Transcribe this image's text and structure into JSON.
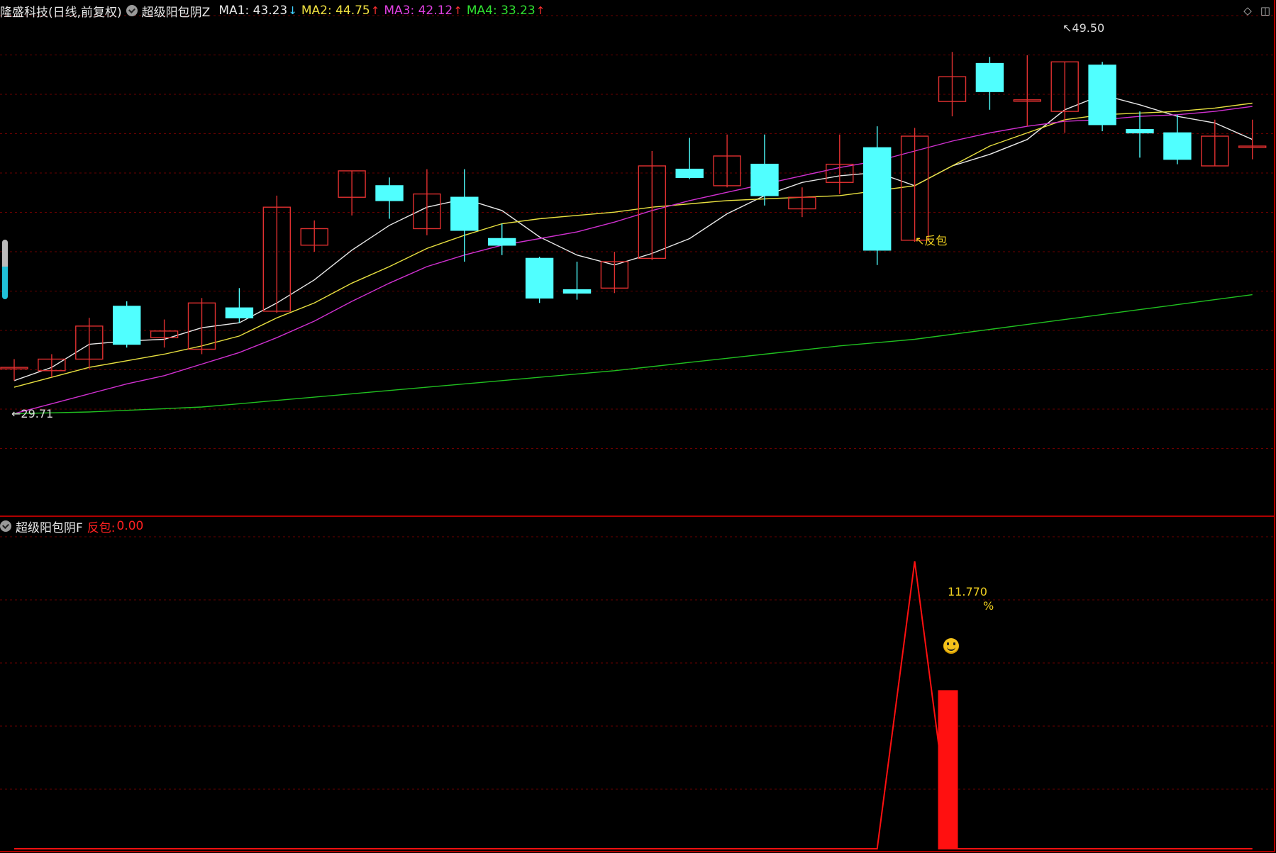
{
  "header": {
    "stock_title": "隆盛科技(日线,前复权)",
    "indicator_name": "超级阳包阴Z",
    "ma": [
      {
        "label": "MA1:",
        "value": "43.23",
        "arrow": "↓",
        "color": "#e8e8e8"
      },
      {
        "label": "MA2:",
        "value": "44.75",
        "arrow": "↑",
        "color": "#f0e040"
      },
      {
        "label": "MA3:",
        "value": "42.12",
        "arrow": "↑",
        "color": "#e040e0"
      },
      {
        "label": "MA4:",
        "value": "33.23",
        "arrow": "↑",
        "color": "#30e030"
      }
    ],
    "arrow_up_color": "#ff3030",
    "arrow_down_color": "#40d0ff"
  },
  "sub_header": {
    "indicator_name": "超级阳包阴F",
    "field_label": "反包:",
    "field_value": "0.00"
  },
  "annotations": {
    "high_label": "49.50",
    "low_label": "29.71",
    "signal_label": "反包",
    "percent_value": "11.770",
    "percent_sign": "%"
  },
  "icons": {
    "collapse": "circle-chevron-icon",
    "diamond": "diamond-icon",
    "window": "window-icon",
    "smiley": "smiley-icon"
  },
  "colors": {
    "up_candle": "#e03030",
    "down_candle": "#50ffff",
    "ma1": "#e8e8e8",
    "ma2": "#e8e040",
    "ma3": "#d030d0",
    "ma4": "#20c020",
    "grid": "#6a0000",
    "signal": "#ff1010"
  },
  "chart_data": [
    {
      "type": "candlestick",
      "y_range": [
        28,
        52
      ],
      "candles": [
        {
          "o": 31.0,
          "h": 31.5,
          "l": 30.2,
          "c": 31.0
        },
        {
          "o": 30.8,
          "h": 31.8,
          "l": 30.4,
          "c": 31.5
        },
        {
          "o": 31.5,
          "h": 34.0,
          "l": 30.9,
          "c": 33.5
        },
        {
          "o": 34.7,
          "h": 35.0,
          "l": 32.2,
          "c": 32.4
        },
        {
          "o": 32.8,
          "h": 33.9,
          "l": 32.2,
          "c": 33.2
        },
        {
          "o": 32.1,
          "h": 35.2,
          "l": 31.8,
          "c": 34.9
        },
        {
          "o": 34.6,
          "h": 35.8,
          "l": 33.7,
          "c": 34.0
        },
        {
          "o": 34.4,
          "h": 41.4,
          "l": 34.3,
          "c": 40.7
        },
        {
          "o": 38.4,
          "h": 39.9,
          "l": 38.0,
          "c": 39.4
        },
        {
          "o": 41.3,
          "h": 42.9,
          "l": 40.2,
          "c": 42.9
        },
        {
          "o": 42.0,
          "h": 42.5,
          "l": 40.0,
          "c": 41.1
        },
        {
          "o": 39.4,
          "h": 43.0,
          "l": 39.0,
          "c": 41.5
        },
        {
          "o": 41.3,
          "h": 43.0,
          "l": 37.4,
          "c": 39.3
        },
        {
          "o": 38.8,
          "h": 39.7,
          "l": 37.8,
          "c": 38.4
        },
        {
          "o": 37.6,
          "h": 37.7,
          "l": 34.9,
          "c": 35.2
        },
        {
          "o": 35.7,
          "h": 37.4,
          "l": 35.1,
          "c": 35.5
        },
        {
          "o": 35.8,
          "h": 38.0,
          "l": 35.5,
          "c": 37.4
        },
        {
          "o": 37.6,
          "h": 44.1,
          "l": 37.5,
          "c": 43.2
        },
        {
          "o": 43.0,
          "h": 44.9,
          "l": 42.4,
          "c": 42.5
        },
        {
          "o": 42.0,
          "h": 45.1,
          "l": 41.9,
          "c": 43.8
        },
        {
          "o": 43.3,
          "h": 45.1,
          "l": 40.8,
          "c": 41.4
        },
        {
          "o": 40.6,
          "h": 41.9,
          "l": 40.1,
          "c": 41.3
        },
        {
          "o": 42.2,
          "h": 45.1,
          "l": 41.5,
          "c": 43.3
        },
        {
          "o": 44.3,
          "h": 45.6,
          "l": 37.2,
          "c": 38.1
        },
        {
          "o": 38.7,
          "h": 45.5,
          "l": 38.6,
          "c": 45.0
        },
        {
          "o": 47.1,
          "h": 50.1,
          "l": 46.2,
          "c": 48.6
        },
        {
          "o": 49.4,
          "h": 49.8,
          "l": 46.6,
          "c": 47.7
        },
        {
          "o": 47.2,
          "h": 49.9,
          "l": 45.6,
          "c": 47.2
        },
        {
          "o": 46.5,
          "h": 49.5,
          "l": 45.2,
          "c": 49.5
        },
        {
          "o": 49.3,
          "h": 49.5,
          "l": 45.3,
          "c": 45.7
        },
        {
          "o": 45.4,
          "h": 46.5,
          "l": 43.7,
          "c": 45.2
        },
        {
          "o": 45.2,
          "h": 46.3,
          "l": 43.3,
          "c": 43.6
        },
        {
          "o": 43.2,
          "h": 46.0,
          "l": 43.2,
          "c": 45.0
        },
        {
          "o": 44.4,
          "h": 46.0,
          "l": 43.6,
          "c": 44.4
        }
      ],
      "series": [
        {
          "name": "MA1",
          "values": [
            30.2,
            31.0,
            32.4,
            32.6,
            32.7,
            33.4,
            33.7,
            34.9,
            36.3,
            38.1,
            39.6,
            40.7,
            41.2,
            40.5,
            38.9,
            37.8,
            37.2,
            37.9,
            38.8,
            40.3,
            41.4,
            42.2,
            42.6,
            42.8,
            42.0,
            43.2,
            43.9,
            44.8,
            46.6,
            47.5,
            46.9,
            46.2,
            45.8,
            44.8
          ]
        },
        {
          "name": "MA2",
          "values": [
            29.8,
            30.4,
            31.0,
            31.4,
            31.8,
            32.3,
            32.9,
            34.0,
            34.9,
            36.1,
            37.1,
            38.2,
            39.0,
            39.7,
            40.0,
            40.2,
            40.4,
            40.7,
            40.9,
            41.1,
            41.2,
            41.3,
            41.4,
            41.7,
            42.0,
            43.2,
            44.4,
            45.2,
            46.0,
            46.3,
            46.4,
            46.5,
            46.7,
            47.0
          ]
        },
        {
          "name": "MA3",
          "values": [
            28.2,
            28.8,
            29.4,
            30.0,
            30.5,
            31.2,
            31.9,
            32.8,
            33.8,
            35.0,
            36.1,
            37.1,
            37.8,
            38.4,
            38.8,
            39.2,
            39.8,
            40.5,
            41.1,
            41.6,
            42.1,
            42.6,
            43.1,
            43.5,
            44.1,
            44.7,
            45.2,
            45.6,
            45.9,
            46.0,
            46.2,
            46.3,
            46.5,
            46.8
          ]
        },
        {
          "name": "MA4",
          "values": [
            28.2,
            28.25,
            28.3,
            28.4,
            28.5,
            28.6,
            28.8,
            29.0,
            29.2,
            29.4,
            29.6,
            29.8,
            30.0,
            30.2,
            30.4,
            30.6,
            30.8,
            31.05,
            31.3,
            31.55,
            31.8,
            32.05,
            32.3,
            32.5,
            32.7,
            33.0,
            33.3,
            33.6,
            33.9,
            34.2,
            34.5,
            34.8,
            35.1,
            35.4
          ]
        }
      ]
    },
    {
      "type": "line",
      "name": "反包",
      "y_range": [
        0,
        14
      ],
      "peak_index": 24,
      "values": [
        0,
        0,
        0,
        0,
        0,
        0,
        0,
        0,
        0,
        0,
        0,
        0,
        0,
        0,
        0,
        0,
        0,
        0,
        0,
        0,
        0,
        0,
        0,
        0,
        12.9,
        0,
        0,
        0,
        0,
        0,
        0,
        0,
        0,
        0
      ],
      "bar": {
        "value": 7.1
      }
    }
  ]
}
